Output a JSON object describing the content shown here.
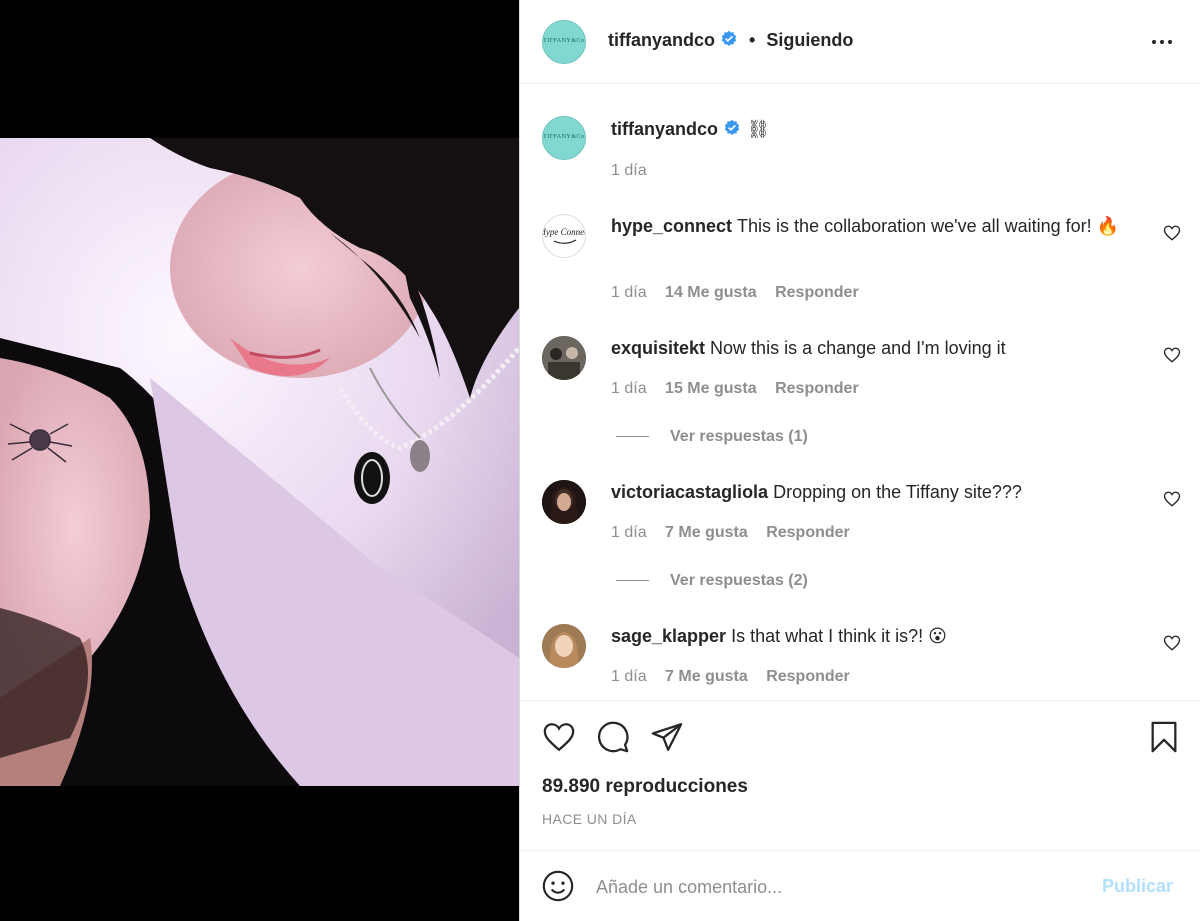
{
  "post": {
    "author": "tiffanyandco",
    "avatar_text": "TIFFANY&Co.",
    "follow_separator": "•",
    "follow_label": "Siguiendo",
    "caption_emoji": "⛓",
    "caption_time": "1 día"
  },
  "comments": [
    {
      "user": "hype_connect",
      "avatar_text": "Hype Connect",
      "text": "This is the collaboration we've all waiting for! 🔥",
      "time": "1 día",
      "likes": "14 Me gusta",
      "reply": "Responder"
    },
    {
      "user": "exquisitekt",
      "text": "Now this is a change and I'm loving it",
      "time": "1 día",
      "likes": "15 Me gusta",
      "reply": "Responder",
      "view_replies": "Ver respuestas (1)"
    },
    {
      "user": "victoriacastagliola",
      "text": "Dropping on the Tiffany site???",
      "time": "1 día",
      "likes": "7 Me gusta",
      "reply": "Responder",
      "view_replies": "Ver respuestas (2)"
    },
    {
      "user": "sage_klapper",
      "text": "Is that what I think it is?! 😮",
      "time": "1 día",
      "likes": "7 Me gusta",
      "reply": "Responder"
    }
  ],
  "stats": {
    "views": "89.890 reproducciones",
    "posted": "HACE UN DÍA"
  },
  "composer": {
    "placeholder": "Añade un comentario...",
    "post_label": "Publicar"
  },
  "icons": {
    "verified": "verified-badge-icon",
    "more": "more-options-icon",
    "like": "heart-icon",
    "comment": "comment-icon",
    "share": "share-icon",
    "save": "bookmark-icon",
    "emoji": "emoji-icon"
  },
  "colors": {
    "tiffany_blue": "#81d8d0",
    "verified_blue": "#3897f0",
    "muted": "#8e8e8e",
    "publish_disabled": "#b2dffc"
  }
}
